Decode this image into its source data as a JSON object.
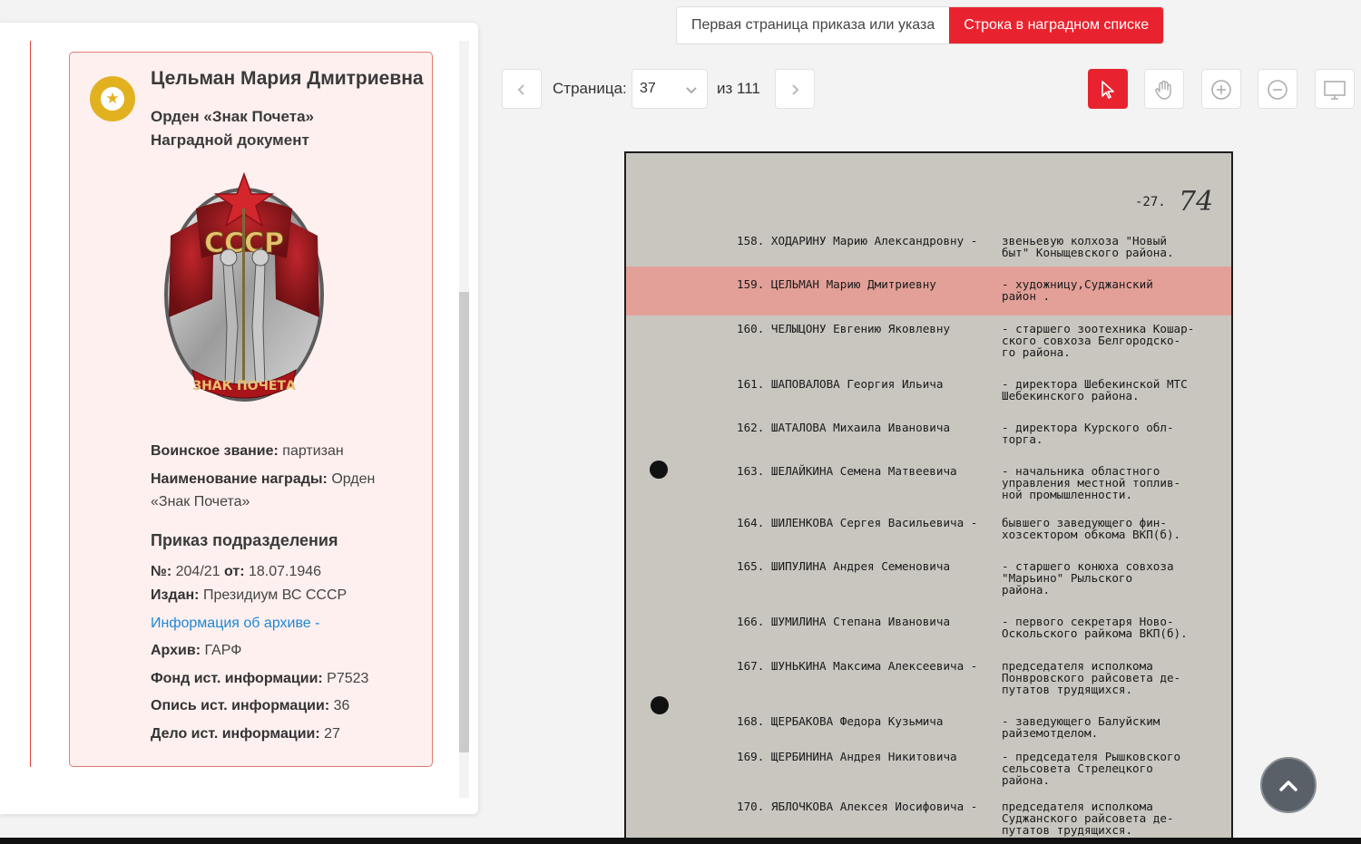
{
  "tabs": {
    "first_page": "Первая страница приказа или указа",
    "award_row": "Строка в наградном списке"
  },
  "pager": {
    "page_label": "Страница:",
    "current_page": "37",
    "total": "из 111"
  },
  "card": {
    "name": "Цельман Мария Дмитриевна",
    "award_line1": "Орден «Знак Почета»",
    "award_line2": "Наградной документ",
    "medal_image": "order-badge-of-honour",
    "rank_label": "Воинское звание:",
    "rank_value": " партизан",
    "award_name_label": "Наименование награды:",
    "award_name_value": " Орден",
    "award_name_value2": "«Знак Почета»",
    "section_title": "Приказ подразделения",
    "number_label": "№:",
    "number_value": " 204/21 ",
    "date_label": "от:",
    "date_value": " 18.07.1946",
    "issued_label": "Издан:",
    "issued_value": " Президиум ВС СССР",
    "archive_info_link": "Информация об архиве -",
    "archive_label": "Архив:",
    "archive_value": " ГАРФ",
    "fond_label": "Фонд ист. информации:",
    "fond_value": " Р7523",
    "opis_label": "Опись ист. информации:",
    "opis_value": " 36",
    "delo_label": "Дело ист. информации:",
    "delo_value": " 27"
  },
  "document": {
    "page_number": "-27.",
    "handwritten": "74",
    "entries": [
      {
        "name": "158. ХОДАРИНУ Марию Александровну -",
        "role": "звеньевую колхоза \"Новый\nбыт\" Коныщевского района."
      },
      {
        "name": "159. ЦЕЛЬМАН Марию Дмитриевну",
        "role": "- художницу,Суджанский\nрайон ."
      },
      {
        "name": "160. ЧЕЛЫЦОНУ Евгению Яковлевну",
        "role": "- старшего зоотехника Кошар-\nского совхоза Белгородско-\nго района."
      },
      {
        "name": "161. ШАПОВАЛОВА Георгия Ильича",
        "role": "- директора Шебекинской МТС\nШебекинского района."
      },
      {
        "name": "162. ШАТАЛОВА Михаила Ивановича",
        "role": "- директора Курского обл-\nторга."
      },
      {
        "name": "163. ШЕЛАЙКИНА Семена Матвеевича",
        "role": "- начальника областного\nуправления местной топлив-\nной промышленности."
      },
      {
        "name": "164. ШИЛЕНКОВА Сергея Васильевича -",
        "role": "бывшего заведующего фин-\nхозсектором обкома ВКП(б)."
      },
      {
        "name": "165. ШИПУЛИНА Андрея Семеновича",
        "role": "- старшего конюха совхоза\n\"Марьино\" Рыльского\nрайона."
      },
      {
        "name": "166. ШУМИЛИНА Степана Ивановича",
        "role": "- первого секретаря Ново-\nОскольского райкома ВКП(б)."
      },
      {
        "name": "167. ШУНЬКИНА Максима Алексеевича -",
        "role": "председателя исполкома\nПонвровского райсовета де-\nпутатов трудящихся."
      },
      {
        "name": "168. ЩЕРБАКОВА Федора Кузьмича",
        "role": "- заведующего Балуйским\nрайземотделом."
      },
      {
        "name": "169. ЩЕРБИНИНА Андрея Никитовича",
        "role": "- председателя Рышковского\nсельсовета Стрелецкого\nрайона."
      },
      {
        "name": "170. ЯБЛОЧКОВА Алексея Иосифовича -",
        "role": "председателя исполкома\nСуджанского райсовета де-\nпутатов трудящихся."
      }
    ]
  },
  "colors": {
    "accent": "#e8232f",
    "card_bg": "#fdf0ef",
    "card_border": "#e37b72",
    "link": "#1e88d6",
    "badge": "#e2b120"
  },
  "icons": {
    "prev": "chevron-left-icon",
    "next": "chevron-right-icon",
    "pointer": "cursor-pointer-icon",
    "hand": "hand-pan-icon",
    "zoom_in": "zoom-in-icon",
    "zoom_out": "zoom-out-icon",
    "fullscreen": "monitor-icon",
    "scroll_top": "chevron-up-icon"
  }
}
